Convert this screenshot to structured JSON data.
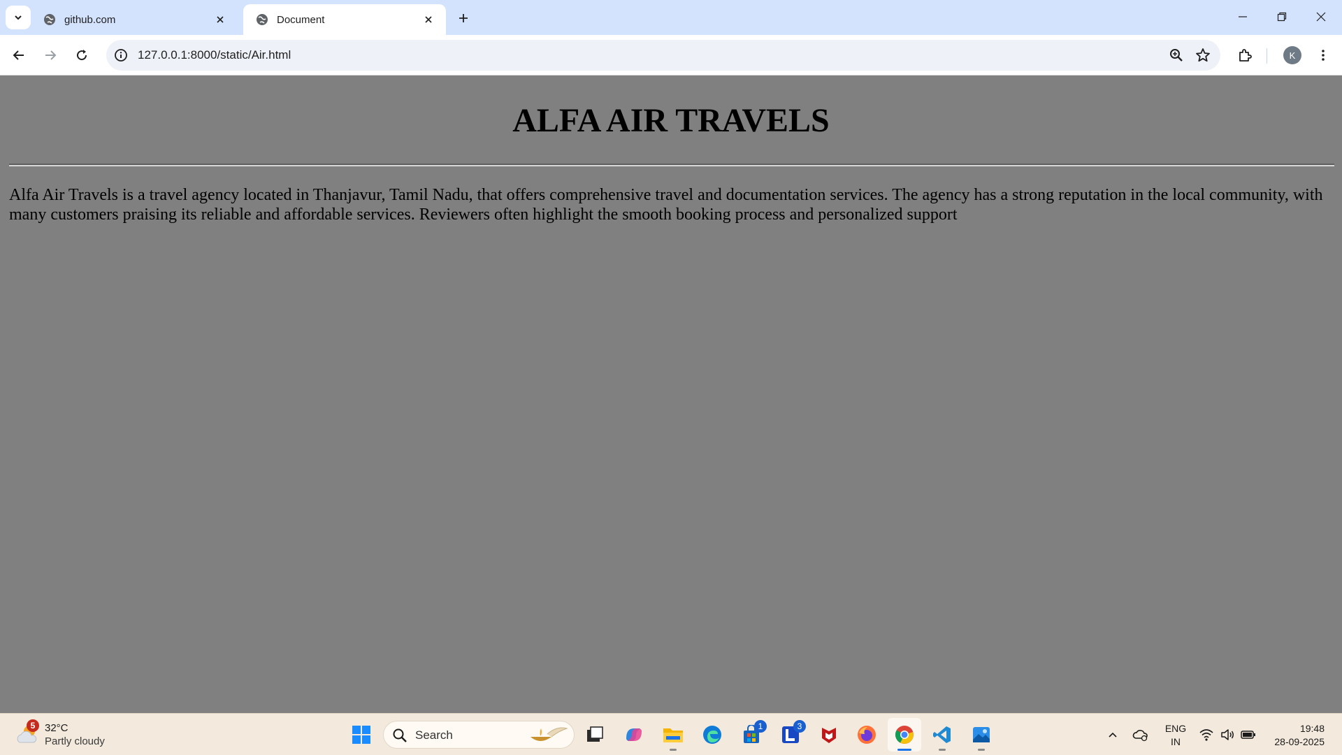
{
  "browser": {
    "tabs": [
      {
        "title": "github.com",
        "active": false
      },
      {
        "title": "Document",
        "active": true
      }
    ],
    "url": "127.0.0.1:8000/static/Air.html",
    "profile_initial": "K",
    "accent_color": "#d3e3fd"
  },
  "page": {
    "heading": "ALFA AIR TRAVELS",
    "paragraph": "Alfa Air Travels is a travel agency located in Thanjavur, Tamil Nadu, that offers comprehensive travel and documentation services. The agency has a strong reputation in the local community, with many customers praising its reliable and affordable services. Reviewers often highlight the smooth booking process and personalized support",
    "background_color": "#808080"
  },
  "taskbar": {
    "weather": {
      "temp": "32°C",
      "condition": "Partly cloudy",
      "badge": "5"
    },
    "search_label": "Search",
    "apps": [
      {
        "name": "start",
        "icon": "windows-logo-icon",
        "running": false
      },
      {
        "name": "task-view",
        "icon": "task-view-icon",
        "running": false
      },
      {
        "name": "copilot",
        "icon": "copilot-icon",
        "running": false
      },
      {
        "name": "file-explorer",
        "icon": "folder-icon",
        "running": true
      },
      {
        "name": "edge",
        "icon": "edge-icon",
        "running": false
      },
      {
        "name": "store",
        "icon": "store-icon",
        "running": false,
        "badge": "1"
      },
      {
        "name": "l-app",
        "icon": "l-app-icon",
        "running": false,
        "badge": "3"
      },
      {
        "name": "mcafee",
        "icon": "mcafee-icon",
        "running": false
      },
      {
        "name": "firefox",
        "icon": "firefox-icon",
        "running": false
      },
      {
        "name": "chrome",
        "icon": "chrome-icon",
        "running": true,
        "active": true
      },
      {
        "name": "vscode",
        "icon": "vscode-icon",
        "running": true
      },
      {
        "name": "photos",
        "icon": "photos-icon",
        "running": true
      }
    ],
    "tray": {
      "lang_line1": "ENG",
      "lang_line2": "IN",
      "time": "19:48",
      "date": "28-09-2025"
    }
  }
}
